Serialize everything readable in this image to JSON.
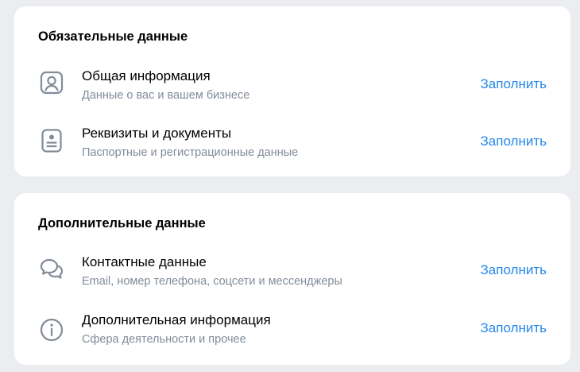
{
  "sections": [
    {
      "title": "Обязательные данные",
      "items": [
        {
          "title": "Общая информация",
          "subtitle": "Данные о вас и вашем бизнесе",
          "action": "Заполнить",
          "icon": "user-square-icon"
        },
        {
          "title": "Реквизиты и документы",
          "subtitle": "Паспортные и регистрационные данные",
          "action": "Заполнить",
          "icon": "id-card-icon"
        }
      ]
    },
    {
      "title": "Дополнительные данные",
      "items": [
        {
          "title": "Контактные данные",
          "subtitle": "Email, номер телефона, соцсети и мессенджеры",
          "action": "Заполнить",
          "icon": "chat-bubbles-icon"
        },
        {
          "title": "Дополнительная информация",
          "subtitle": "Сфера деятельности и прочее",
          "action": "Заполнить",
          "icon": "info-circle-icon"
        }
      ]
    }
  ],
  "colors": {
    "background": "#ebedf0",
    "card": "#ffffff",
    "accent": "#2688eb",
    "secondary_text": "#818c99",
    "icon": "#818c99"
  }
}
